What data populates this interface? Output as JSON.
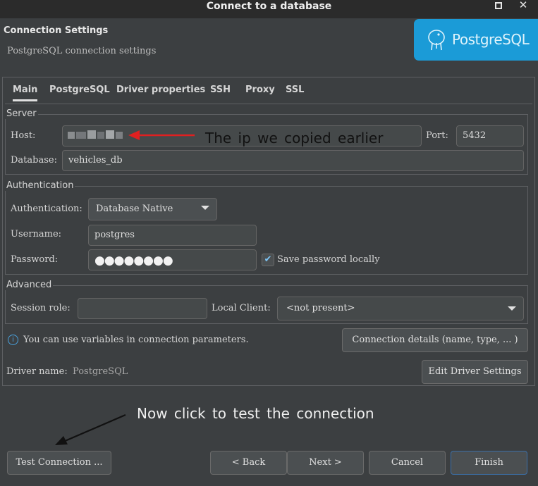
{
  "window": {
    "title": "Connect to a database",
    "maximize_icon": "maximize-icon",
    "close_glyph": "✕"
  },
  "header": {
    "title": "Connection Settings",
    "subtitle": "PostgreSQL connection settings",
    "logo_text": "PostgreSQL",
    "logo_color": "#1b9bd7"
  },
  "tabs": [
    {
      "label": "Main",
      "active": true
    },
    {
      "label": "PostgreSQL",
      "active": false
    },
    {
      "label": "Driver properties",
      "active": false
    },
    {
      "label": "SSH",
      "active": false
    },
    {
      "label": "Proxy",
      "active": false
    },
    {
      "label": "SSL",
      "active": false
    }
  ],
  "server": {
    "group_label": "Server",
    "host_label": "Host:",
    "host_value_redacted": true,
    "port_label": "Port:",
    "port_value": "5432",
    "database_label": "Database:",
    "database_value": "vehicles_db"
  },
  "authentication": {
    "group_label": "Authentication",
    "type_label": "Authentication:",
    "type_value": "Database Native",
    "username_label": "Username:",
    "username_value": "postgres",
    "password_label": "Password:",
    "password_mask": "●●●●●●●●",
    "save_password_label": "Save password locally",
    "save_password_checked": true
  },
  "advanced": {
    "group_label": "Advanced",
    "session_role_label": "Session role:",
    "session_role_value": "",
    "local_client_label": "Local Client:",
    "local_client_value": "<not present>"
  },
  "info": {
    "icon": "info-icon",
    "text": "You can use variables in connection parameters.",
    "connection_details_button": "Connection details (name, type, ... )"
  },
  "driver": {
    "label": "Driver name:",
    "value": "PostgreSQL",
    "edit_button": "Edit Driver Settings"
  },
  "annotations": {
    "ip_note": "The ip we copied earlier",
    "ip_note_color": "#111111",
    "arrow1_color": "#e02020",
    "test_note": "Now click to test the connection",
    "arrow2_color": "#111111"
  },
  "footer": {
    "test_button": "Test Connection ...",
    "back_button": "< Back",
    "next_button": "Next >",
    "cancel_button": "Cancel",
    "finish_button": "Finish"
  }
}
